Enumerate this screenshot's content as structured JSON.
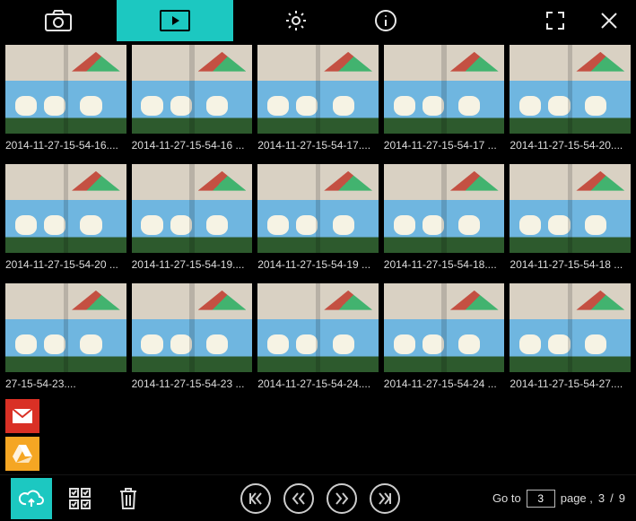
{
  "colors": {
    "accent": "#1cc8c1",
    "mail": "#d93025",
    "drive": "#f5a623"
  },
  "topbar": {
    "tabs": [
      {
        "name": "camera-tab",
        "icon": "camera-icon",
        "active": false
      },
      {
        "name": "gallery-tab",
        "icon": "play-icon",
        "active": true
      }
    ],
    "right": [
      {
        "name": "settings-button",
        "icon": "gear-icon"
      },
      {
        "name": "info-button",
        "icon": "info-icon"
      },
      {
        "name": "fullscreen-button",
        "icon": "expand-icon"
      },
      {
        "name": "close-button",
        "icon": "close-icon"
      }
    ]
  },
  "gallery": {
    "items": [
      {
        "caption": "2014-11-27-15-54-16...."
      },
      {
        "caption": "2014-11-27-15-54-16 ..."
      },
      {
        "caption": "2014-11-27-15-54-17...."
      },
      {
        "caption": "2014-11-27-15-54-17 ..."
      },
      {
        "caption": "2014-11-27-15-54-20...."
      },
      {
        "caption": "2014-11-27-15-54-20 ..."
      },
      {
        "caption": "2014-11-27-15-54-19...."
      },
      {
        "caption": "2014-11-27-15-54-19 ..."
      },
      {
        "caption": "2014-11-27-15-54-18...."
      },
      {
        "caption": "2014-11-27-15-54-18 ..."
      },
      {
        "caption": "27-15-54-23...."
      },
      {
        "caption": "2014-11-27-15-54-23 ..."
      },
      {
        "caption": "2014-11-27-15-54-24...."
      },
      {
        "caption": "2014-11-27-15-54-24 ..."
      },
      {
        "caption": "2014-11-27-15-54-27...."
      }
    ]
  },
  "share": {
    "items": [
      {
        "name": "share-mail-button",
        "icon": "mail-icon"
      },
      {
        "name": "share-drive-button",
        "icon": "drive-icon"
      }
    ]
  },
  "bottombar": {
    "upload_name": "upload-button",
    "select_name": "select-all-button",
    "delete_name": "delete-button",
    "nav": [
      {
        "name": "first-page-button",
        "icon": "first-icon"
      },
      {
        "name": "prev-page-button",
        "icon": "prev-icon"
      },
      {
        "name": "next-page-button",
        "icon": "next-icon"
      },
      {
        "name": "last-page-button",
        "icon": "last-icon"
      }
    ],
    "pager": {
      "goto_label": "Go to",
      "page_value": "3",
      "page_word": "page ,",
      "current": "3",
      "sep": "/",
      "total": "9"
    }
  }
}
